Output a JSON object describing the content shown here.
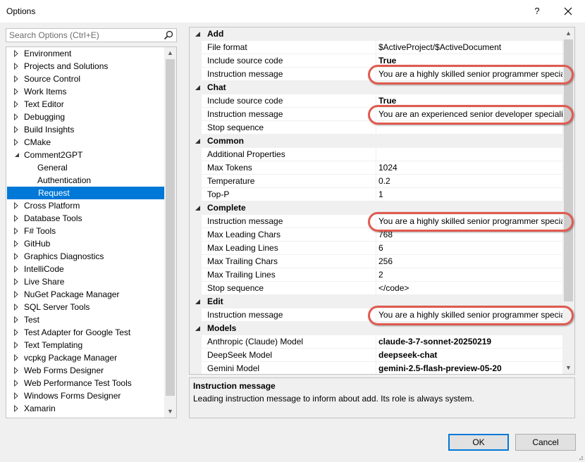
{
  "window": {
    "title": "Options",
    "help_label": "?",
    "close_label": "✕"
  },
  "search": {
    "placeholder": "Search Options (Ctrl+E)",
    "value": ""
  },
  "tree": {
    "items": [
      {
        "label": "Environment",
        "level": 0,
        "expanded": false
      },
      {
        "label": "Projects and Solutions",
        "level": 0,
        "expanded": false
      },
      {
        "label": "Source Control",
        "level": 0,
        "expanded": false
      },
      {
        "label": "Work Items",
        "level": 0,
        "expanded": false
      },
      {
        "label": "Text Editor",
        "level": 0,
        "expanded": false
      },
      {
        "label": "Debugging",
        "level": 0,
        "expanded": false
      },
      {
        "label": "Build Insights",
        "level": 0,
        "expanded": false
      },
      {
        "label": "CMake",
        "level": 0,
        "expanded": false
      },
      {
        "label": "Comment2GPT",
        "level": 0,
        "expanded": true
      },
      {
        "label": "General",
        "level": 1
      },
      {
        "label": "Authentication",
        "level": 1
      },
      {
        "label": "Request",
        "level": 1,
        "selected": true
      },
      {
        "label": "Cross Platform",
        "level": 0,
        "expanded": false
      },
      {
        "label": "Database Tools",
        "level": 0,
        "expanded": false
      },
      {
        "label": "F# Tools",
        "level": 0,
        "expanded": false
      },
      {
        "label": "GitHub",
        "level": 0,
        "expanded": false
      },
      {
        "label": "Graphics Diagnostics",
        "level": 0,
        "expanded": false
      },
      {
        "label": "IntelliCode",
        "level": 0,
        "expanded": false
      },
      {
        "label": "Live Share",
        "level": 0,
        "expanded": false
      },
      {
        "label": "NuGet Package Manager",
        "level": 0,
        "expanded": false
      },
      {
        "label": "SQL Server Tools",
        "level": 0,
        "expanded": false
      },
      {
        "label": "Test",
        "level": 0,
        "expanded": false
      },
      {
        "label": "Test Adapter for Google Test",
        "level": 0,
        "expanded": false
      },
      {
        "label": "Text Templating",
        "level": 0,
        "expanded": false
      },
      {
        "label": "vcpkg Package Manager",
        "level": 0,
        "expanded": false
      },
      {
        "label": "Web Forms Designer",
        "level": 0,
        "expanded": false
      },
      {
        "label": "Web Performance Test Tools",
        "level": 0,
        "expanded": false
      },
      {
        "label": "Windows Forms Designer",
        "level": 0,
        "expanded": false
      },
      {
        "label": "Xamarin",
        "level": 0,
        "expanded": false
      }
    ],
    "scroll_position": 0.0
  },
  "grid": {
    "rows": [
      {
        "kind": "category",
        "label": "Add"
      },
      {
        "kind": "prop",
        "name": "File format",
        "value": "$ActiveProject/$ActiveDocument",
        "bold": false
      },
      {
        "kind": "prop",
        "name": "Include source code",
        "value": "True",
        "bold": true
      },
      {
        "kind": "prop",
        "name": "Instruction message",
        "value": "You are a highly skilled senior programmer specializing in",
        "bold": false,
        "highlighted": true
      },
      {
        "kind": "category",
        "label": "Chat"
      },
      {
        "kind": "prop",
        "name": "Include source code",
        "value": "True",
        "bold": true
      },
      {
        "kind": "prop",
        "name": "Instruction message",
        "value": "You are an experienced senior developer specializing in",
        "bold": false,
        "highlighted": true
      },
      {
        "kind": "prop",
        "name": "Stop sequence",
        "value": "",
        "bold": false
      },
      {
        "kind": "category",
        "label": "Common"
      },
      {
        "kind": "prop",
        "name": "Additional Properties",
        "value": "",
        "bold": false
      },
      {
        "kind": "prop",
        "name": "Max Tokens",
        "value": "1024",
        "bold": false
      },
      {
        "kind": "prop",
        "name": "Temperature",
        "value": "0.2",
        "bold": false
      },
      {
        "kind": "prop",
        "name": "Top-P",
        "value": "1",
        "bold": false
      },
      {
        "kind": "category",
        "label": "Complete"
      },
      {
        "kind": "prop",
        "name": "Instruction message",
        "value": "You are a highly skilled senior programmer specializing in",
        "bold": false,
        "highlighted": true
      },
      {
        "kind": "prop",
        "name": "Max Leading Chars",
        "value": "768",
        "bold": false
      },
      {
        "kind": "prop",
        "name": "Max Leading Lines",
        "value": "6",
        "bold": false
      },
      {
        "kind": "prop",
        "name": "Max Trailing Chars",
        "value": "256",
        "bold": false
      },
      {
        "kind": "prop",
        "name": "Max Trailing Lines",
        "value": "2",
        "bold": false
      },
      {
        "kind": "prop",
        "name": "Stop sequence",
        "value": "</code>",
        "bold": false
      },
      {
        "kind": "category",
        "label": "Edit"
      },
      {
        "kind": "prop",
        "name": "Instruction message",
        "value": "You are a highly skilled senior programmer specializing in",
        "bold": false,
        "highlighted": true
      },
      {
        "kind": "category",
        "label": "Models"
      },
      {
        "kind": "prop",
        "name": "Anthropic (Claude) Model",
        "value": "claude-3-7-sonnet-20250219",
        "bold": true
      },
      {
        "kind": "prop",
        "name": "DeepSeek Model",
        "value": "deepseek-chat",
        "bold": true
      },
      {
        "kind": "prop",
        "name": "Gemini Model",
        "value": "gemini-2.5-flash-preview-05-20",
        "bold": true
      }
    ],
    "scroll_position": 0.0
  },
  "description": {
    "title": "Instruction message",
    "text": "Leading instruction message to inform about add. Its role is always system."
  },
  "buttons": {
    "ok": "OK",
    "cancel": "Cancel"
  },
  "colors": {
    "selection": "#0078d7",
    "highlight_oval": "#e05a4f",
    "ok_border": "#0078d7"
  }
}
